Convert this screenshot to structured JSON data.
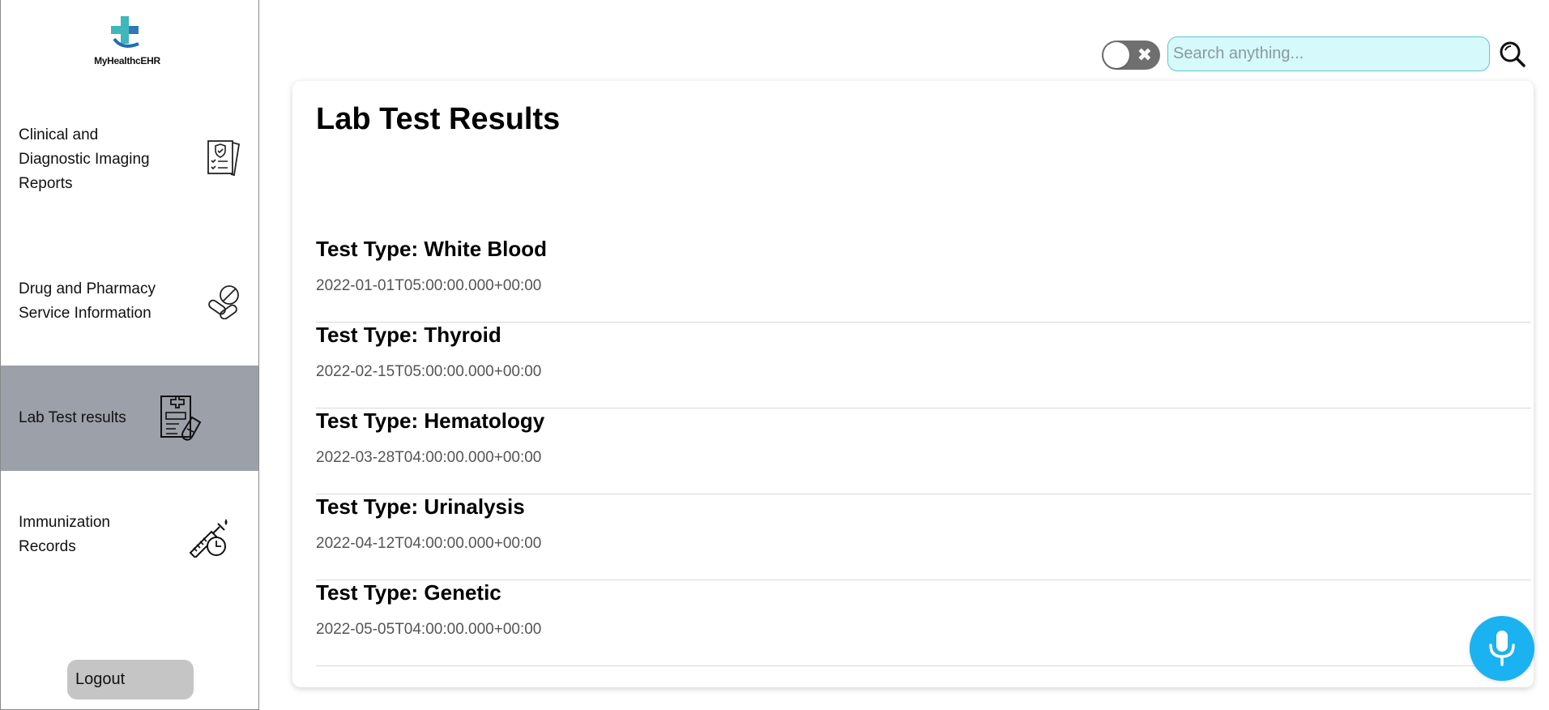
{
  "sidebar": {
    "logo_text": "MyHealthcEHR",
    "items": [
      {
        "label": "Clinical and Diagnostic Imaging Reports",
        "icon": "clipboard-report-icon"
      },
      {
        "label": "Drug and Pharmacy Service Information",
        "icon": "pills-icon"
      },
      {
        "label": "Lab Test results",
        "icon": "lab-test-tube-icon",
        "active": true
      },
      {
        "label": "Immunization Records",
        "icon": "syringe-clock-icon"
      }
    ],
    "logout_label": "Logout"
  },
  "topbar": {
    "toggle_icon": "close-icon",
    "search_placeholder": "Search anything...",
    "search_value": "",
    "search_button_icon": "search-icon"
  },
  "main": {
    "title": "Lab Test Results",
    "results": [
      {
        "type": "Test Type: White Blood",
        "date": "2022-01-01T05:00:00.000+00:00"
      },
      {
        "type": "Test Type: Thyroid",
        "date": "2022-02-15T05:00:00.000+00:00"
      },
      {
        "type": "Test Type: Hematology",
        "date": "2022-03-28T04:00:00.000+00:00"
      },
      {
        "type": "Test Type: Urinalysis",
        "date": "2022-04-12T04:00:00.000+00:00"
      },
      {
        "type": "Test Type: Genetic",
        "date": "2022-05-05T04:00:00.000+00:00"
      }
    ]
  },
  "colors": {
    "active_nav_bg": "#9ca0a8",
    "search_bg": "#d6f9fb",
    "mic_button": "#1ab2f0",
    "logo_teal": "#1fa9b2"
  },
  "mic_icon": "microphone-icon"
}
